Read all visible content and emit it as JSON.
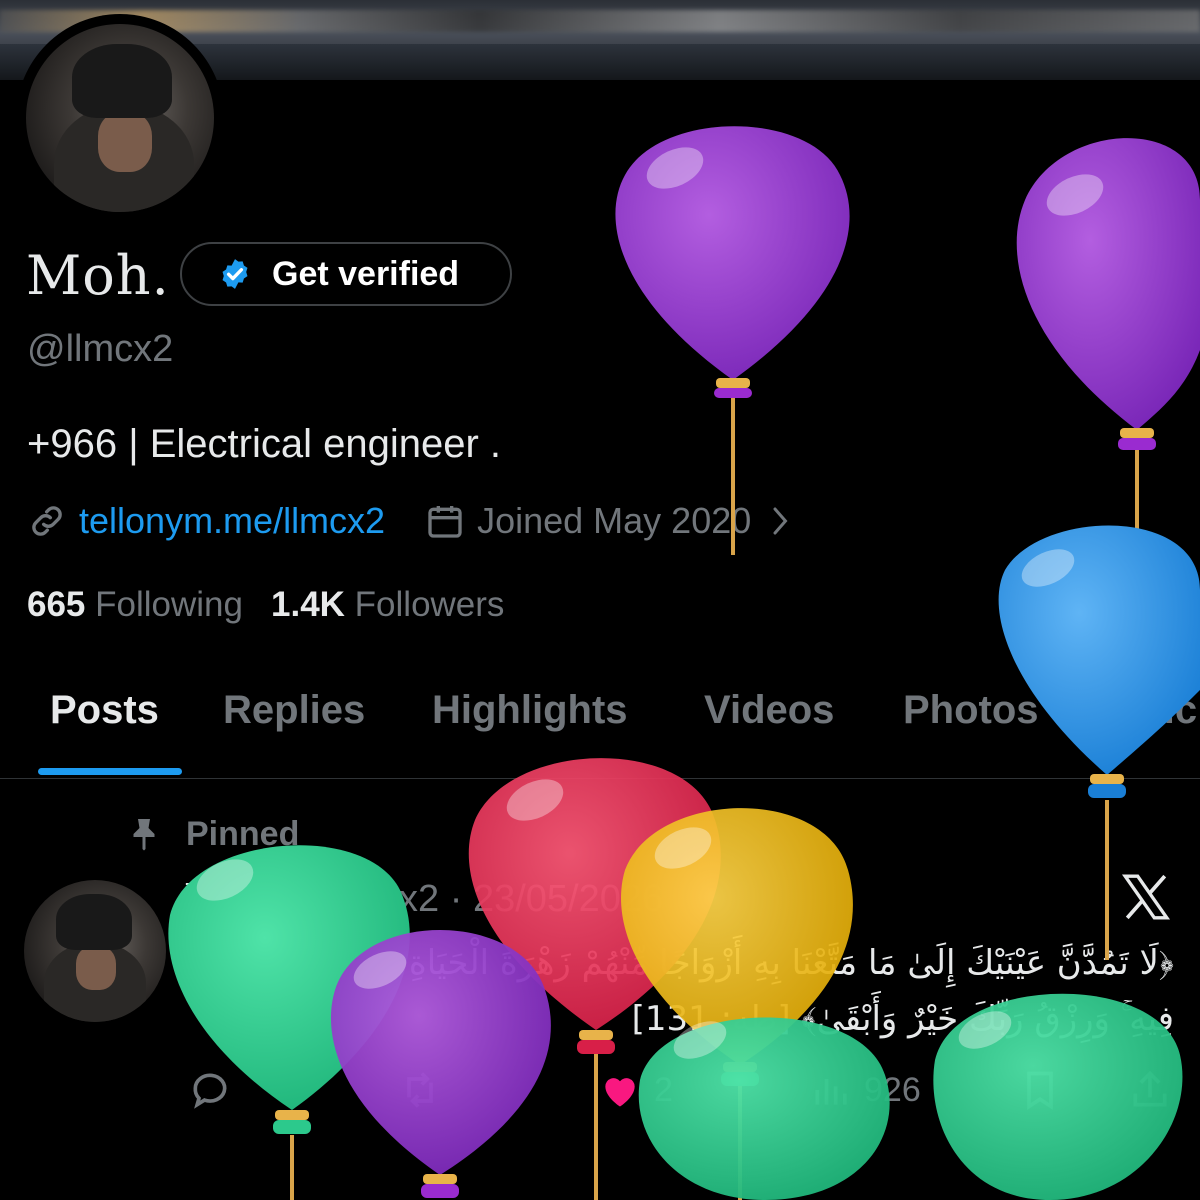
{
  "profile": {
    "name": "Moh.",
    "verify_label": "Get verified",
    "handle": "@llmcx2",
    "bio": "+966 | Electrical engineer .",
    "link": "tellonym.me/llmcx2",
    "joined": "Joined May 2020",
    "following_count": "665",
    "following_label": "Following",
    "followers_count": "1.4K",
    "followers_label": "Followers"
  },
  "tabs": [
    {
      "label": "Posts",
      "active": true
    },
    {
      "label": "Replies"
    },
    {
      "label": "Highlights"
    },
    {
      "label": "Videos"
    },
    {
      "label": "Photos"
    },
    {
      "label": "Artic"
    }
  ],
  "post": {
    "pinned_label": "Pinned",
    "author": "Moh.",
    "handle": "@llmcx2",
    "separator": "·",
    "date": "23/05/2026",
    "text": "﴿لَا تَمُدَّنَّ عَيْنَيْكَ إِلَىٰ مَا مَتَّعْنَا بِهِ أَزْوَاجًا مِّنْهُمْ زَهْرَةَ الْحَيَاةِ الدُّنْيَا لِنَفْتِنَهُمْ فِيهِ ۚ وَرِزْقُ رَبِّكَ خَيْرٌ وَأَبْقَىٰ﴾ [طه: 131]",
    "likes": "2",
    "views": "926"
  },
  "icons": {
    "verify": "verified-badge-icon",
    "link": "link-icon",
    "calendar": "calendar-icon",
    "chevron": "chevron-right-icon",
    "pin": "pin-icon",
    "x": "x-logo-icon",
    "reply": "reply-icon",
    "repost": "repost-icon",
    "like": "heart-icon",
    "views": "views-icon",
    "bookmark": "bookmark-icon",
    "share": "share-icon"
  },
  "colors": {
    "accent": "#1d9bf0",
    "muted": "#71767b",
    "like": "#f91880"
  }
}
